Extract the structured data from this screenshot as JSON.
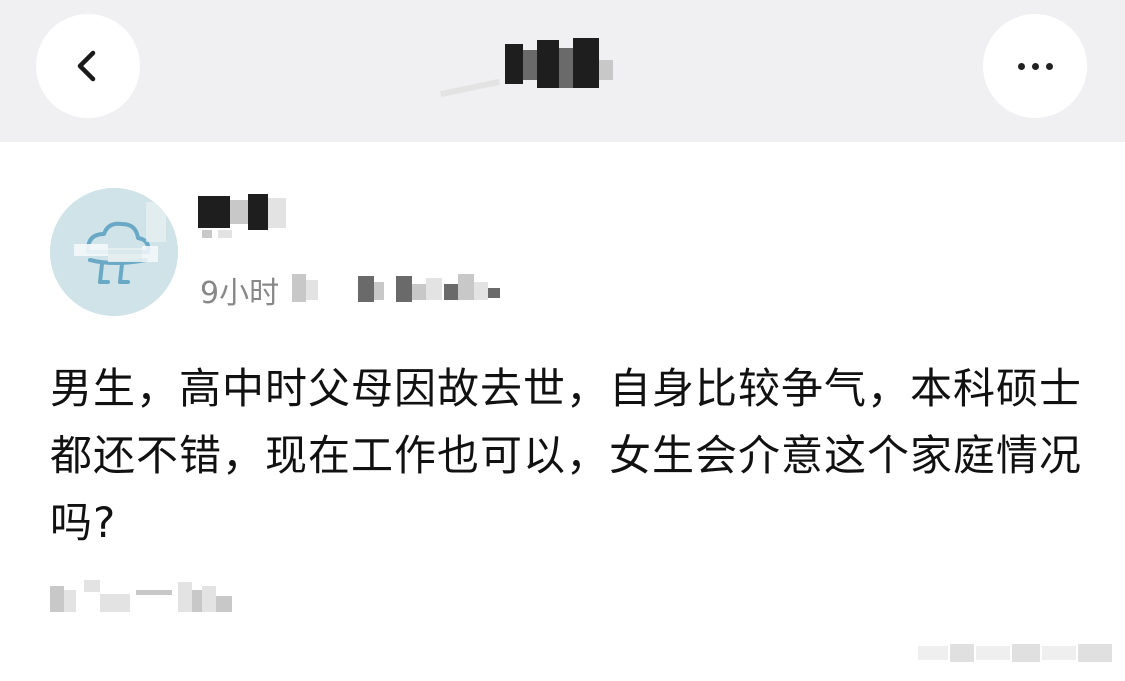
{
  "header": {
    "title": "",
    "back_icon": "chevron-left-icon",
    "more_icon": "more-horizontal-icon"
  },
  "post": {
    "author": "",
    "time": "9小时",
    "content": "男生，高中时父母因故去世，自身比较争气，本科硕士都还不错，现在工作也可以，女生会介意这个家庭情况吗?",
    "avatar_icon": "cloud-character-icon"
  },
  "colors": {
    "topbar_bg": "#f0f0f2",
    "avatar_bg": "#cfe3e8",
    "avatar_line": "#6aa9c6",
    "meta_text": "#888888",
    "body_text": "#111111"
  }
}
